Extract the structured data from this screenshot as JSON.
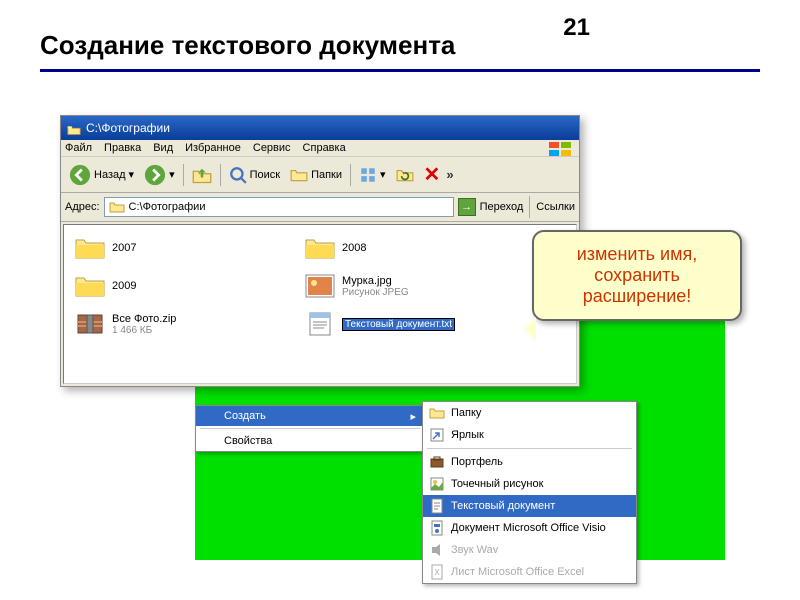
{
  "page": {
    "number": "21",
    "title": "Создание текстового документа"
  },
  "explorer": {
    "title": "C:\\Фотографии",
    "menu": [
      "Файл",
      "Правка",
      "Вид",
      "Избранное",
      "Сервис",
      "Справка"
    ],
    "toolbar": {
      "back": "Назад",
      "search": "Поиск",
      "folders": "Папки",
      "more": "»"
    },
    "addressbar": {
      "label": "Адрес:",
      "path": "C:\\Фотографии",
      "go": "Переход",
      "links": "Ссылки"
    },
    "items": [
      {
        "name": "2007",
        "type": "folder"
      },
      {
        "name": "2008",
        "type": "folder"
      },
      {
        "name": "2009",
        "type": "folder"
      },
      {
        "name": "Мурка.jpg",
        "sub": "Рисунок JPEG",
        "type": "image"
      },
      {
        "name": "Все Фото.zip",
        "sub": "1 466 КБ",
        "type": "zip"
      },
      {
        "name": "Текстовый документ.txt",
        "type": "text",
        "editing": true
      }
    ]
  },
  "callout": {
    "line1": "изменить имя,",
    "line2": "сохранить",
    "line3": "расширение!"
  },
  "context1": {
    "create": "Создать",
    "properties": "Свойства"
  },
  "context2": {
    "items": [
      {
        "label": "Папку",
        "icon": "folder"
      },
      {
        "label": "Ярлык",
        "icon": "shortcut"
      },
      {
        "label": "Портфель",
        "icon": "briefcase"
      },
      {
        "label": "Точечный рисунок",
        "icon": "bmp"
      },
      {
        "label": "Текстовый документ",
        "icon": "txt",
        "hl": true
      },
      {
        "label": "Документ Microsoft Office Visio",
        "icon": "visio"
      },
      {
        "label": "Звук Wav",
        "icon": "wav",
        "dim": true
      },
      {
        "label": "Лист Microsoft Office Excel",
        "icon": "xls",
        "dim": true
      }
    ]
  }
}
